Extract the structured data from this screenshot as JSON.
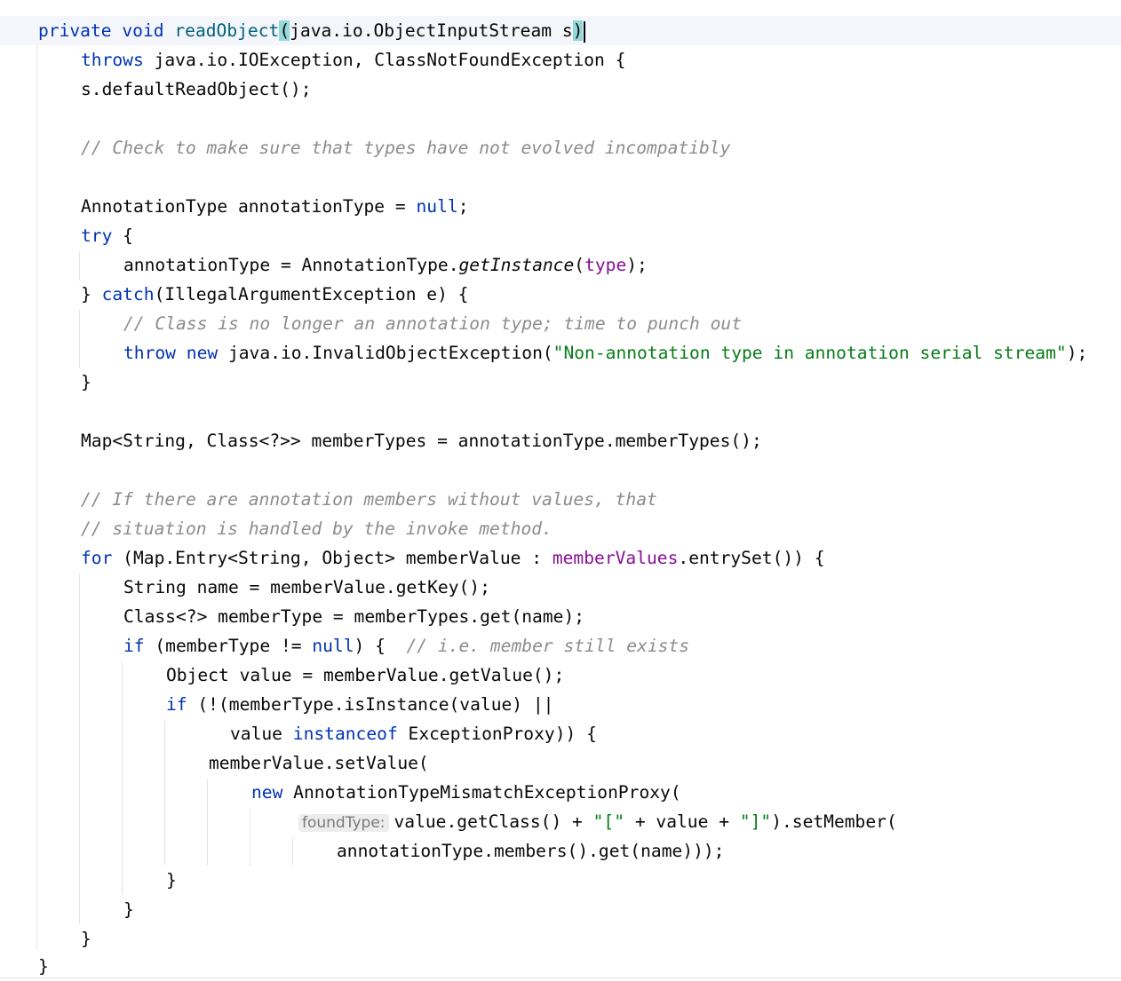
{
  "code": {
    "l1": {
      "kw1": "private void ",
      "method": "readObject",
      "paren_open": "(",
      "params": "java.io.ObjectInputStream s",
      "paren_close": ")"
    },
    "l2": {
      "kw": "throws",
      "rest": " java.io.IOException, ClassNotFoundException {"
    },
    "l3": {
      "text": "s.defaultReadObject();"
    },
    "l5": {
      "comment": "// Check to make sure that types have not evolved incompatibly"
    },
    "l7": {
      "pre": "AnnotationType annotationType = ",
      "kw": "null",
      "post": ";"
    },
    "l8": {
      "kw": "try",
      "post": " {"
    },
    "l9": {
      "pre": "annotationType = AnnotationType.",
      "call": "getInstance",
      "open": "(",
      "field": "type",
      "close": ");"
    },
    "l10": {
      "pre": "} ",
      "kw": "catch",
      "post": "(IllegalArgumentException e) {"
    },
    "l11": {
      "comment": "// Class is no longer an annotation type; time to punch out"
    },
    "l12": {
      "kw1": "throw",
      "sp": " ",
      "kw2": "new",
      "pre": " java.io.InvalidObjectException(",
      "str": "\"Non-annotation type in annotation serial stream\"",
      "post": ");"
    },
    "l13": {
      "text": "}"
    },
    "l15": {
      "text": "Map<String, Class<?>> memberTypes = annotationType.memberTypes();"
    },
    "l17": {
      "comment": "// If there are annotation members without values, that"
    },
    "l18": {
      "comment": "// situation is handled by the invoke method."
    },
    "l19": {
      "kw": "for",
      "pre": " (Map.Entry<String, Object> memberValue : ",
      "field": "memberValues",
      "post": ".entrySet()) {"
    },
    "l20": {
      "text": "String name = memberValue.getKey();"
    },
    "l21": {
      "text": "Class<?> memberType = memberTypes.get(name);"
    },
    "l22": {
      "kw": "if",
      "pre": " (memberType != ",
      "kw2": "null",
      "post": ") {  ",
      "comment": "// i.e. member still exists"
    },
    "l23": {
      "text": "Object value = memberValue.getValue();"
    },
    "l24": {
      "kw": "if",
      "post": " (!(memberType.isInstance(value) ||"
    },
    "l25": {
      "pre": "value ",
      "kw": "instanceof",
      "post": " ExceptionProxy)) {"
    },
    "l26": {
      "text": "memberValue.setValue("
    },
    "l27": {
      "kw": "new",
      "post": " AnnotationTypeMismatchExceptionProxy("
    },
    "l28": {
      "hint": "foundType:",
      "pre": "value.getClass() + ",
      "s1": "\"[\"",
      "mid": " + value + ",
      "s2": "\"]\"",
      "post": ").setMember("
    },
    "l29": {
      "text": "annotationType.members().get(name)));"
    },
    "l30": {
      "text": "}"
    },
    "l31": {
      "text": "}"
    },
    "l32": {
      "text": "}"
    },
    "l33": {
      "text": "}"
    }
  }
}
